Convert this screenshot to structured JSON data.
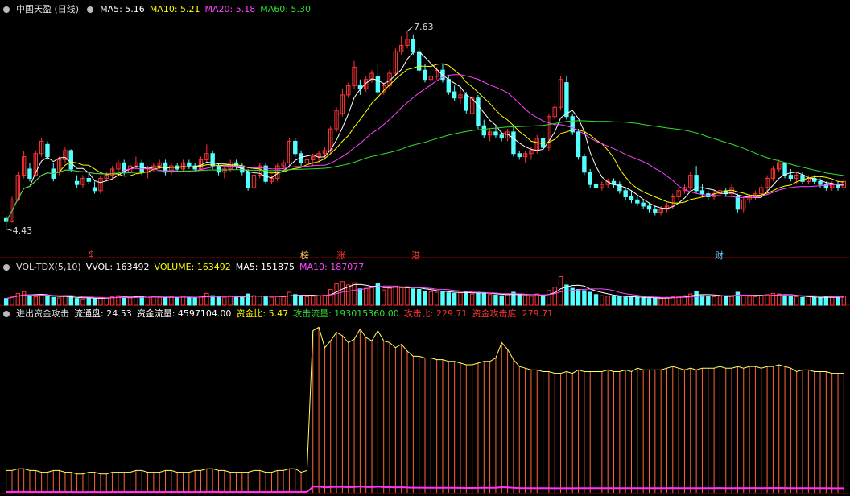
{
  "headers": {
    "main": [
      {
        "text": "中国天盈 (日线)",
        "color": "#dcdcdc"
      },
      {
        "text": "MA5: 5.16",
        "color": "#ffffff"
      },
      {
        "text": "MA10: 5.21",
        "color": "#ffff00"
      },
      {
        "text": "MA20: 5.18",
        "color": "#ff44ff"
      },
      {
        "text": "MA60: 5.30",
        "color": "#33dd33"
      }
    ],
    "volume": [
      {
        "text": "VOL-TDX(5,10)",
        "color": "#dcdcdc"
      },
      {
        "text": "VVOL: 163492",
        "color": "#ffffff"
      },
      {
        "text": "VOLUME: 163492",
        "color": "#ffff00"
      },
      {
        "text": "MA5: 151875",
        "color": "#ffffff"
      },
      {
        "text": "MA10: 187077",
        "color": "#ff44ff"
      }
    ],
    "indicator": [
      {
        "text": "进出资金攻击",
        "color": "#dcdcdc"
      },
      {
        "text": "流通盘: 24.53",
        "color": "#ffffff"
      },
      {
        "text": "资金流量: 4597104.00",
        "color": "#ffffff"
      },
      {
        "text": "资金比: 5.47",
        "color": "#ffff00"
      },
      {
        "text": "攻击流量: 193015360.00",
        "color": "#33dd33"
      },
      {
        "text": "攻击比: 229.71",
        "color": "#ff3333"
      },
      {
        "text": "资金攻击度: 279.71",
        "color": "#ff3333"
      }
    ]
  },
  "annotations": {
    "high_label": "7.63",
    "low_label": "4.43",
    "markers": [
      {
        "text": "$",
        "color": "#ff3333"
      },
      {
        "text": "榜",
        "color": "#ffcc66"
      },
      {
        "text": "涨",
        "color": "#ff3333"
      },
      {
        "text": "港",
        "color": "#ff3333"
      },
      {
        "text": "财",
        "color": "#66ccff"
      }
    ]
  },
  "colors": {
    "up": "#ff3333",
    "down": "#54ffff",
    "ma5": "#ffffff",
    "ma10": "#ffff00",
    "ma20": "#ff44ff",
    "ma60": "#33dd33",
    "flow_line": "#ffff66",
    "flow_bar": "#ff6633",
    "flow_base": "#ff33ff"
  },
  "chart_data": [
    {
      "type": "candlestick",
      "title": "中国天盈 (日线)",
      "ohlc": [
        [
          4.6,
          4.65,
          4.43,
          4.55
        ],
        [
          4.55,
          4.95,
          4.53,
          4.9
        ],
        [
          4.9,
          5.35,
          4.88,
          5.3
        ],
        [
          5.3,
          5.7,
          5.25,
          5.6
        ],
        [
          5.4,
          5.5,
          5.2,
          5.25
        ],
        [
          5.3,
          5.7,
          5.28,
          5.65
        ],
        [
          5.65,
          5.9,
          5.6,
          5.85
        ],
        [
          5.8,
          5.85,
          5.55,
          5.6
        ],
        [
          5.4,
          5.5,
          5.2,
          5.25
        ],
        [
          5.35,
          5.6,
          5.3,
          5.55
        ],
        [
          5.55,
          5.75,
          5.5,
          5.7
        ],
        [
          5.7,
          5.72,
          5.35,
          5.4
        ],
        [
          5.2,
          5.3,
          5.1,
          5.15
        ],
        [
          5.15,
          5.3,
          5.1,
          5.25
        ],
        [
          5.25,
          5.35,
          5.15,
          5.2
        ],
        [
          5.1,
          5.2,
          5.0,
          5.05
        ],
        [
          5.05,
          5.3,
          5.0,
          5.25
        ],
        [
          5.25,
          5.35,
          5.2,
          5.3
        ],
        [
          5.3,
          5.45,
          5.25,
          5.4
        ],
        [
          5.4,
          5.55,
          5.35,
          5.5
        ],
        [
          5.5,
          5.55,
          5.3,
          5.35
        ],
        [
          5.35,
          5.5,
          5.3,
          5.45
        ],
        [
          5.45,
          5.6,
          5.4,
          5.5
        ],
        [
          5.5,
          5.55,
          5.3,
          5.35
        ],
        [
          5.35,
          5.45,
          5.25,
          5.4
        ],
        [
          5.4,
          5.5,
          5.35,
          5.45
        ],
        [
          5.45,
          5.55,
          5.4,
          5.5
        ],
        [
          5.5,
          5.55,
          5.3,
          5.35
        ],
        [
          5.35,
          5.5,
          5.3,
          5.45
        ],
        [
          5.45,
          5.5,
          5.35,
          5.4
        ],
        [
          5.4,
          5.55,
          5.35,
          5.5
        ],
        [
          5.5,
          5.55,
          5.4,
          5.45
        ],
        [
          5.45,
          5.5,
          5.35,
          5.4
        ],
        [
          5.4,
          5.6,
          5.38,
          5.55
        ],
        [
          5.55,
          5.8,
          5.5,
          5.65
        ],
        [
          5.65,
          5.7,
          5.4,
          5.45
        ],
        [
          5.45,
          5.5,
          5.3,
          5.35
        ],
        [
          5.35,
          5.45,
          5.25,
          5.4
        ],
        [
          5.4,
          5.55,
          5.35,
          5.5
        ],
        [
          5.5,
          5.55,
          5.4,
          5.45
        ],
        [
          5.45,
          5.5,
          5.3,
          5.35
        ],
        [
          5.35,
          5.4,
          5.05,
          5.1
        ],
        [
          5.1,
          5.35,
          5.05,
          5.3
        ],
        [
          5.3,
          5.5,
          5.25,
          5.45
        ],
        [
          5.45,
          5.5,
          5.15,
          5.2
        ],
        [
          5.2,
          5.3,
          5.15,
          5.25
        ],
        [
          5.25,
          5.5,
          5.2,
          5.45
        ],
        [
          5.45,
          5.55,
          5.35,
          5.5
        ],
        [
          5.5,
          5.9,
          5.45,
          5.85
        ],
        [
          5.85,
          5.9,
          5.6,
          5.65
        ],
        [
          5.65,
          5.7,
          5.45,
          5.5
        ],
        [
          5.5,
          5.6,
          5.45,
          5.55
        ],
        [
          5.55,
          5.65,
          5.45,
          5.6
        ],
        [
          5.6,
          5.7,
          5.5,
          5.65
        ],
        [
          5.65,
          5.75,
          5.55,
          5.7
        ],
        [
          5.7,
          6.1,
          5.65,
          6.05
        ],
        [
          6.05,
          6.4,
          6.0,
          6.35
        ],
        [
          6.3,
          6.7,
          6.25,
          6.6
        ],
        [
          6.6,
          6.8,
          6.55,
          6.75
        ],
        [
          6.75,
          7.15,
          6.7,
          7.05
        ],
        [
          6.75,
          6.85,
          6.6,
          6.7
        ],
        [
          6.7,
          6.9,
          6.65,
          6.85
        ],
        [
          6.85,
          7.0,
          6.8,
          6.95
        ],
        [
          6.9,
          7.1,
          6.55,
          6.65
        ],
        [
          6.65,
          6.8,
          6.6,
          6.75
        ],
        [
          6.75,
          7.0,
          6.7,
          6.95
        ],
        [
          6.95,
          7.35,
          6.9,
          7.3
        ],
        [
          7.3,
          7.55,
          7.25,
          7.4
        ],
        [
          7.4,
          7.63,
          7.35,
          7.5
        ],
        [
          7.5,
          7.58,
          7.25,
          7.3
        ],
        [
          7.3,
          7.35,
          6.95,
          7.0
        ],
        [
          7.0,
          7.1,
          6.8,
          6.85
        ],
        [
          6.85,
          6.95,
          6.7,
          6.9
        ],
        [
          6.9,
          7.05,
          6.85,
          7.0
        ],
        [
          7.0,
          7.1,
          6.8,
          6.85
        ],
        [
          6.85,
          6.9,
          6.6,
          6.65
        ],
        [
          6.65,
          6.75,
          6.5,
          6.55
        ],
        [
          6.55,
          6.7,
          6.45,
          6.6
        ],
        [
          6.6,
          6.65,
          6.3,
          6.35
        ],
        [
          6.3,
          6.6,
          6.25,
          6.55
        ],
        [
          6.55,
          6.6,
          6.05,
          6.1
        ],
        [
          6.1,
          6.2,
          5.9,
          5.95
        ],
        [
          5.95,
          6.05,
          5.85,
          6.0
        ],
        [
          6.0,
          6.1,
          5.9,
          5.95
        ],
        [
          5.95,
          6.0,
          5.85,
          5.9
        ],
        [
          5.9,
          6.05,
          5.85,
          6.0
        ],
        [
          6.0,
          6.1,
          5.6,
          5.65
        ],
        [
          5.65,
          5.7,
          5.55,
          5.6
        ],
        [
          5.6,
          5.7,
          5.5,
          5.65
        ],
        [
          5.65,
          5.75,
          5.55,
          5.7
        ],
        [
          5.7,
          5.95,
          5.65,
          5.9
        ],
        [
          5.9,
          5.95,
          5.7,
          5.75
        ],
        [
          5.75,
          6.3,
          5.7,
          6.25
        ],
        [
          6.25,
          6.45,
          6.2,
          6.4
        ],
        [
          6.4,
          6.9,
          6.35,
          6.85
        ],
        [
          6.8,
          6.9,
          6.2,
          6.25
        ],
        [
          6.25,
          6.3,
          5.95,
          6.0
        ],
        [
          6.0,
          6.05,
          5.55,
          5.6
        ],
        [
          5.6,
          5.65,
          5.3,
          5.35
        ],
        [
          5.35,
          5.4,
          5.1,
          5.15
        ],
        [
          5.15,
          5.25,
          5.05,
          5.1
        ],
        [
          5.1,
          5.2,
          5.05,
          5.15
        ],
        [
          5.15,
          5.25,
          5.1,
          5.2
        ],
        [
          5.2,
          5.25,
          5.1,
          5.15
        ],
        [
          5.15,
          5.2,
          5.0,
          5.05
        ],
        [
          5.05,
          5.1,
          4.9,
          4.95
        ],
        [
          4.95,
          5.05,
          4.85,
          4.9
        ],
        [
          4.9,
          4.95,
          4.8,
          4.85
        ],
        [
          4.85,
          4.9,
          4.75,
          4.8
        ],
        [
          4.8,
          4.85,
          4.7,
          4.75
        ],
        [
          4.75,
          4.8,
          4.65,
          4.7
        ],
        [
          4.7,
          4.8,
          4.65,
          4.75
        ],
        [
          4.75,
          4.85,
          4.7,
          4.8
        ],
        [
          4.8,
          5.0,
          4.75,
          4.95
        ],
        [
          4.95,
          5.1,
          4.9,
          5.05
        ],
        [
          5.05,
          5.15,
          5.0,
          5.1
        ],
        [
          5.1,
          5.35,
          5.05,
          5.3
        ],
        [
          5.3,
          5.45,
          5.0,
          5.05
        ],
        [
          5.05,
          5.15,
          4.95,
          5.0
        ],
        [
          5.0,
          5.05,
          4.9,
          4.95
        ],
        [
          4.95,
          5.05,
          4.9,
          5.0
        ],
        [
          5.0,
          5.1,
          4.95,
          5.05
        ],
        [
          5.05,
          5.1,
          4.95,
          5.0
        ],
        [
          5.0,
          5.15,
          4.95,
          5.1
        ],
        [
          4.95,
          5.0,
          4.7,
          4.75
        ],
        [
          4.75,
          4.95,
          4.7,
          4.9
        ],
        [
          4.9,
          5.0,
          4.85,
          4.95
        ],
        [
          4.95,
          5.05,
          4.9,
          5.0
        ],
        [
          5.0,
          5.15,
          4.95,
          5.1
        ],
        [
          5.1,
          5.3,
          5.05,
          5.25
        ],
        [
          5.25,
          5.45,
          5.2,
          5.4
        ],
        [
          5.4,
          5.55,
          5.35,
          5.5
        ],
        [
          5.5,
          5.45,
          5.25,
          5.3
        ],
        [
          5.3,
          5.4,
          5.2,
          5.25
        ],
        [
          5.25,
          5.35,
          5.15,
          5.3
        ],
        [
          5.3,
          5.35,
          5.15,
          5.2
        ],
        [
          5.2,
          5.3,
          5.15,
          5.25
        ],
        [
          5.25,
          5.3,
          5.15,
          5.2
        ],
        [
          5.2,
          5.25,
          5.1,
          5.15
        ],
        [
          5.15,
          5.2,
          5.05,
          5.1
        ],
        [
          5.1,
          5.2,
          5.05,
          5.15
        ],
        [
          5.15,
          5.2,
          5.05,
          5.1
        ],
        [
          5.1,
          5.25,
          5.05,
          5.2
        ]
      ],
      "ylim": [
        4.2,
        7.85
      ],
      "moving_averages": [
        {
          "name": "MA5",
          "period": 5
        },
        {
          "name": "MA10",
          "period": 10
        },
        {
          "name": "MA20",
          "period": 20
        },
        {
          "name": "MA60",
          "period": 60
        }
      ]
    },
    {
      "type": "bar",
      "title": "VOL-TDX(5,10)",
      "values": [
        120,
        160,
        210,
        240,
        180,
        150,
        190,
        170,
        140,
        130,
        160,
        150,
        120,
        110,
        130,
        120,
        140,
        130,
        150,
        170,
        140,
        130,
        150,
        160,
        140,
        150,
        140,
        130,
        150,
        140,
        160,
        140,
        130,
        150,
        210,
        170,
        150,
        140,
        160,
        150,
        140,
        200,
        170,
        160,
        150,
        140,
        160,
        150,
        230,
        190,
        170,
        150,
        160,
        170,
        180,
        280,
        380,
        420,
        360,
        400,
        290,
        300,
        320,
        380,
        270,
        300,
        340,
        310,
        330,
        290,
        280,
        250,
        240,
        230,
        250,
        220,
        210,
        220,
        240,
        200,
        230,
        210,
        190,
        180,
        170,
        190,
        230,
        180,
        170,
        160,
        200,
        170,
        260,
        320,
        510,
        360,
        300,
        280,
        260,
        230,
        190,
        170,
        160,
        150,
        160,
        140,
        150,
        140,
        130,
        120,
        130,
        120,
        140,
        150,
        160,
        170,
        200,
        240,
        170,
        160,
        150,
        160,
        150,
        170,
        230,
        180,
        160,
        150,
        170,
        190,
        210,
        200,
        170,
        160,
        150,
        140,
        150,
        140,
        130,
        150,
        140,
        150,
        163
      ],
      "ylim": [
        0,
        560
      ]
    },
    {
      "type": "bar",
      "title": "进出资金攻击",
      "values": [
        13,
        13,
        14,
        14,
        13,
        13,
        12,
        12,
        13,
        13,
        12,
        12,
        11,
        11,
        12,
        12,
        11,
        11,
        12,
        12,
        12,
        12,
        13,
        13,
        12,
        12,
        12,
        13,
        13,
        12,
        12,
        12,
        13,
        13,
        14,
        14,
        13,
        13,
        12,
        12,
        12,
        12,
        13,
        13,
        12,
        12,
        13,
        13,
        14,
        14,
        12,
        13,
        95,
        97,
        85,
        89,
        94,
        92,
        88,
        90,
        96,
        91,
        89,
        95,
        89,
        88,
        85,
        87,
        83,
        80,
        80,
        79,
        79,
        78,
        78,
        77,
        77,
        76,
        75,
        75,
        76,
        77,
        77,
        79,
        88,
        84,
        78,
        74,
        73,
        72,
        72,
        71,
        71,
        70,
        70,
        71,
        70,
        72,
        71,
        71,
        71,
        71,
        72,
        71,
        71,
        72,
        71,
        73,
        72,
        72,
        72,
        72,
        73,
        74,
        73,
        72,
        73,
        72,
        73,
        73,
        73,
        74,
        73,
        73,
        74,
        73,
        74,
        74,
        73,
        74,
        74,
        75,
        74,
        73,
        71,
        72,
        72,
        71,
        71,
        71,
        70,
        70,
        70
      ],
      "ylim": [
        0,
        100
      ]
    }
  ]
}
